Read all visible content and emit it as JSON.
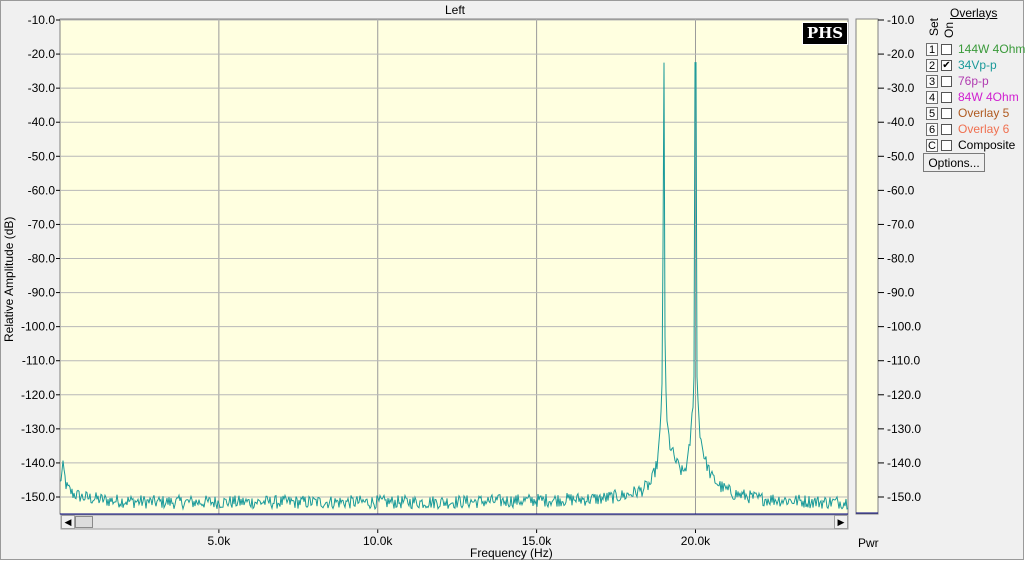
{
  "chart_data": {
    "type": "line",
    "title": "Left",
    "xlabel": "Frequency (Hz)",
    "ylabel": "Relative Amplitude (dB)",
    "xlim": [
      0,
      24800
    ],
    "ylim": [
      -155,
      -10
    ],
    "grid": true,
    "x_ticks": [
      "5.0k",
      "10.0k",
      "15.0k",
      "20.0k"
    ],
    "x_tick_values": [
      5000,
      10000,
      15000,
      20000
    ],
    "y_ticks": [
      "-10.0",
      "-20.0",
      "-30.0",
      "-40.0",
      "-50.0",
      "-60.0",
      "-70.0",
      "-80.0",
      "-90.0",
      "-100.0",
      "-110.0",
      "-120.0",
      "-130.0",
      "-140.0",
      "-150.0"
    ],
    "y_tick_values": [
      -10,
      -20,
      -30,
      -40,
      -50,
      -60,
      -70,
      -80,
      -90,
      -100,
      -110,
      -120,
      -130,
      -140,
      -150
    ],
    "right_axis_label": "Pwr",
    "series": [
      {
        "color": "#1a9a9a",
        "points": [
          [
            0,
            -146
          ],
          [
            100,
            -141
          ],
          [
            200,
            -147
          ],
          [
            400,
            -149
          ],
          [
            700,
            -150
          ],
          [
            1500,
            -151
          ],
          [
            3000,
            -151.5
          ],
          [
            6000,
            -151.5
          ],
          [
            9000,
            -151.5
          ],
          [
            12000,
            -151.5
          ],
          [
            15000,
            -151
          ],
          [
            17000,
            -150.5
          ],
          [
            17800,
            -149.5
          ],
          [
            18300,
            -148
          ],
          [
            18600,
            -146
          ],
          [
            18800,
            -140
          ],
          [
            18900,
            -130
          ],
          [
            18950,
            -115
          ],
          [
            18990,
            -60
          ],
          [
            19000,
            -22.5
          ],
          [
            19010,
            -60
          ],
          [
            19050,
            -115
          ],
          [
            19100,
            -128
          ],
          [
            19200,
            -135
          ],
          [
            19400,
            -140
          ],
          [
            19600,
            -143
          ],
          [
            19750,
            -140
          ],
          [
            19850,
            -132
          ],
          [
            19950,
            -118
          ],
          [
            19990,
            -65
          ],
          [
            20000,
            -22.5
          ],
          [
            20010,
            -65
          ],
          [
            20050,
            -118
          ],
          [
            20150,
            -132
          ],
          [
            20300,
            -139
          ],
          [
            20500,
            -144
          ],
          [
            20800,
            -147
          ],
          [
            21200,
            -149
          ],
          [
            22000,
            -150.5
          ],
          [
            23000,
            -151
          ],
          [
            24000,
            -151.5
          ],
          [
            24800,
            -151.5
          ]
        ]
      }
    ]
  },
  "overlays": {
    "title": "Overlays",
    "set_label": "Set",
    "on_label": "On",
    "items": [
      {
        "set": "1",
        "label": "144W 4Ohm",
        "checked": false,
        "color": "#3a9a3a"
      },
      {
        "set": "2",
        "label": "34Vp-p",
        "checked": true,
        "color": "#1a9a9a"
      },
      {
        "set": "3",
        "label": "76p-p",
        "checked": false,
        "color": "#b03ab0"
      },
      {
        "set": "4",
        "label": "84W 4Ohm",
        "checked": false,
        "color": "#d020d0"
      },
      {
        "set": "5",
        "label": "Overlay 5",
        "checked": false,
        "color": "#b05a20"
      },
      {
        "set": "6",
        "label": "Overlay 6",
        "checked": false,
        "color": "#f07050"
      },
      {
        "set": "C",
        "label": "Composite",
        "checked": false,
        "color": "#000000"
      }
    ],
    "options_label": "Options..."
  },
  "logo_text": "PHS",
  "scroll_left_icon": "arrow-left-icon",
  "scroll_right_icon": "arrow-right-icon"
}
